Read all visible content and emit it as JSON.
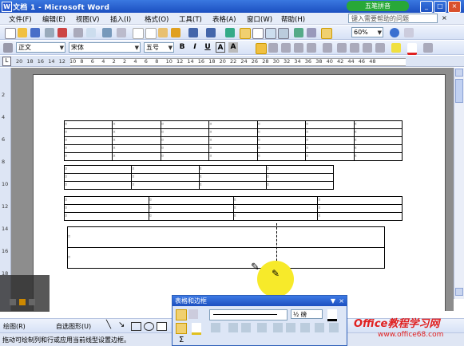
{
  "window": {
    "title": "文档 1 - Microsoft Word",
    "ime_label": "五笔拼音",
    "controls": [
      "_",
      "□",
      "×"
    ]
  },
  "menubar": {
    "items": [
      "文件(F)",
      "编辑(E)",
      "视图(V)",
      "插入(I)",
      "格式(O)",
      "工具(T)",
      "表格(A)",
      "窗口(W)",
      "帮助(H)"
    ],
    "help_placeholder": "键入需要帮助的问题"
  },
  "standard_toolbar": {
    "zoom": "60%"
  },
  "formatting_toolbar": {
    "style": "正文",
    "font": "宋体",
    "size": "五号",
    "buttons": [
      "B",
      "I",
      "U",
      "A",
      "A"
    ]
  },
  "ruler": {
    "labels": [
      "20",
      "18",
      "16",
      "14",
      "12",
      "10",
      "8",
      "6",
      "4",
      "2",
      "2",
      "4",
      "6",
      "8",
      "10",
      "12",
      "14",
      "16",
      "18",
      "20",
      "22",
      "24",
      "26",
      "28",
      "30",
      "32",
      "34",
      "36",
      "38",
      "40",
      "42",
      "44",
      "46",
      "48"
    ]
  },
  "vruler": {
    "labels": [
      "2",
      "4",
      "6",
      "8",
      "10",
      "12",
      "14",
      "16",
      "18"
    ]
  },
  "tables_and_borders": {
    "title": "表格和边框",
    "line_weight": "½ 磅",
    "sum": "Σ"
  },
  "drawing_toolbar": {
    "draw_label": "绘图(R)",
    "autoshapes_label": "自选图形(U)"
  },
  "status_text": "拖动可绘制列和行或应用当前线型设置边框。",
  "watermark": {
    "text": "Office教程学习网",
    "url": "www.office68.com"
  },
  "colors": {
    "title_blue": "#1c4fc0",
    "toolbar_bg": "#dde6f6",
    "highlight": "#f7ea2a"
  }
}
